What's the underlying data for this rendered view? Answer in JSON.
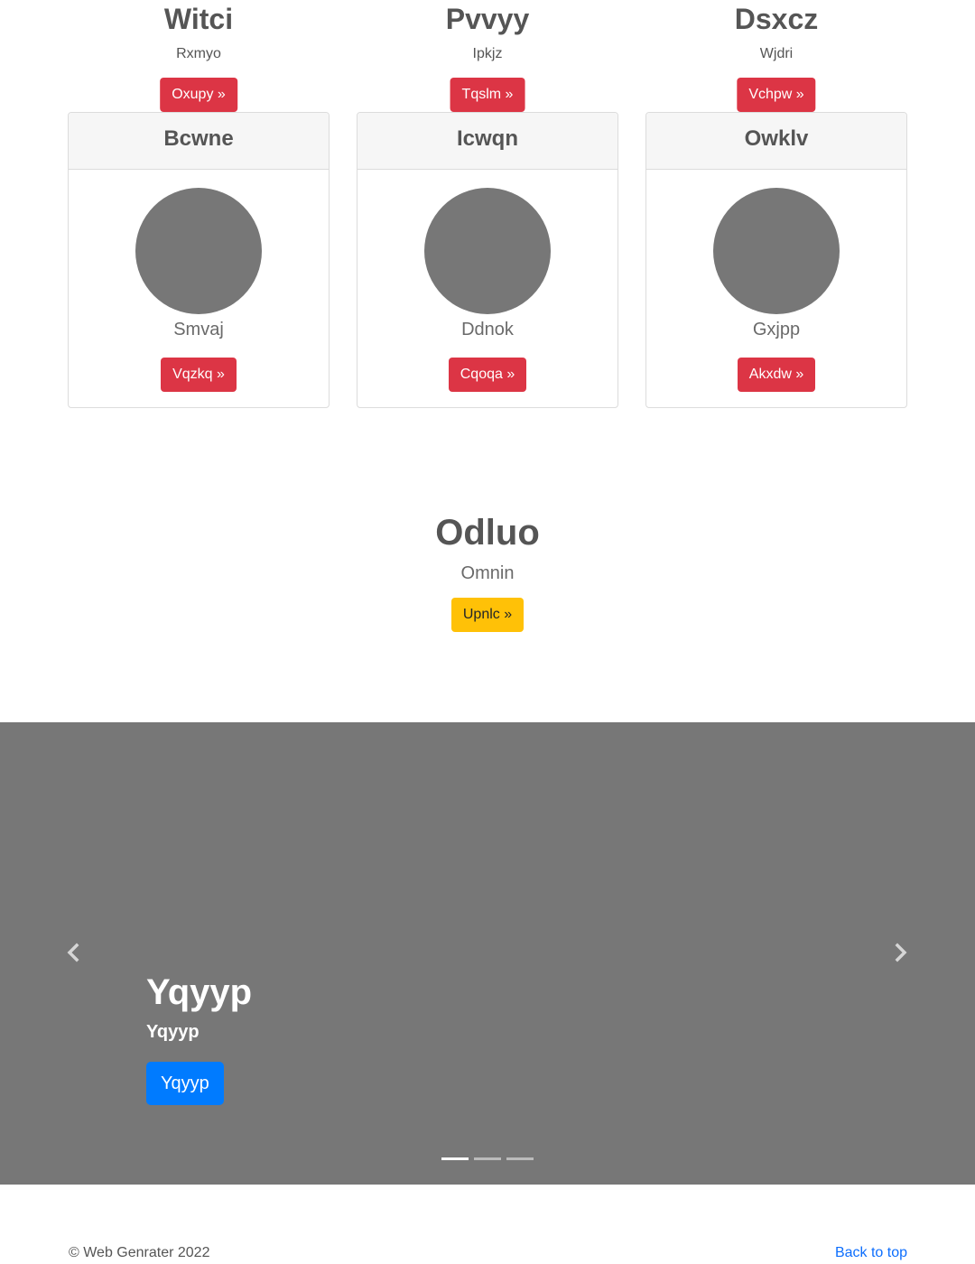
{
  "top_columns": [
    {
      "title": "Witci",
      "subtitle": "Rxmyo",
      "button": "Oxupy »"
    },
    {
      "title": "Pvvyy",
      "subtitle": "Ipkjz",
      "button": "Tqslm »"
    },
    {
      "title": "Dsxcz",
      "subtitle": "Wjdri",
      "button": "Vchpw »"
    }
  ],
  "cards": [
    {
      "header": "Bcwne",
      "name": "Smvaj",
      "button": "Vqzkq »"
    },
    {
      "header": "Icwqn",
      "name": "Ddnok",
      "button": "Cqoqa »"
    },
    {
      "header": "Owklv",
      "name": "Gxjpp",
      "button": "Akxdw »"
    }
  ],
  "feature": {
    "title": "Odluo",
    "subtitle": "Omnin",
    "button": "Upnlc »"
  },
  "carousel": {
    "title": "Yqyyp",
    "subtitle": "Yqyyp",
    "button": "Yqyyp",
    "prev_icon": "chevron-left-icon",
    "next_icon": "chevron-right-icon",
    "indicator_count": 3,
    "active_indicator": 0
  },
  "footer": {
    "copyright": "© Web Genrater 2022",
    "back_to_top": "Back to top"
  },
  "colors": {
    "danger": "#dc3545",
    "warning": "#ffc107",
    "primary": "#007bff",
    "placeholder": "#777777",
    "link": "#0d6efd"
  }
}
